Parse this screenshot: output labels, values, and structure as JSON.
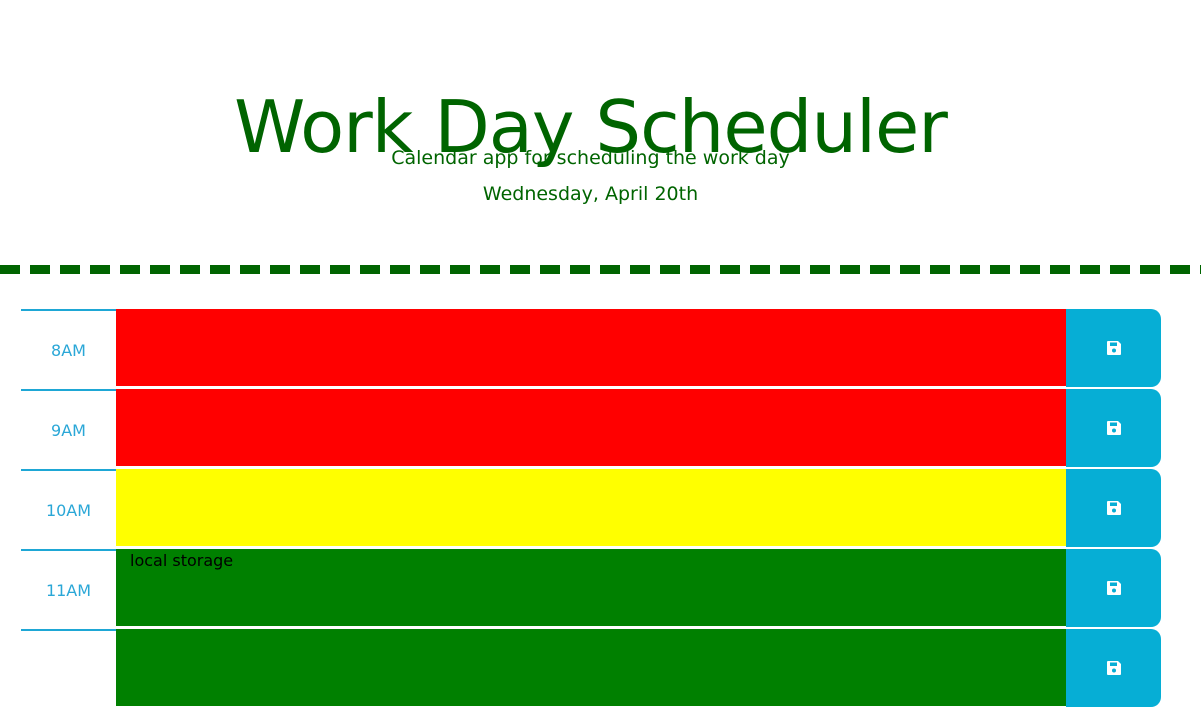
{
  "header": {
    "title": "Work Day Scheduler",
    "subtitle": "Calendar app for scheduling the work day",
    "current_day": "Wednesday, April 20th"
  },
  "colors": {
    "past": "#ff0000",
    "present": "#ffff00",
    "future": "#008000",
    "save_button": "#06aed5",
    "hour_text": "#2aa7d7",
    "header_text": "#006400"
  },
  "schedule": {
    "blocks": [
      {
        "hour": "8AM",
        "status": "past",
        "text": "",
        "save_icon": "save-icon"
      },
      {
        "hour": "9AM",
        "status": "past",
        "text": "",
        "save_icon": "save-icon"
      },
      {
        "hour": "10AM",
        "status": "present",
        "text": "",
        "save_icon": "save-icon"
      },
      {
        "hour": "11AM",
        "status": "future",
        "text": "local storage",
        "save_icon": "save-icon"
      },
      {
        "hour": "",
        "status": "future",
        "text": "",
        "save_icon": "save-icon"
      }
    ]
  }
}
